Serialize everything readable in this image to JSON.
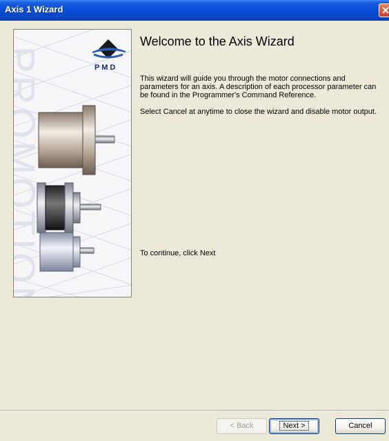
{
  "window": {
    "title": "Axis 1 Wizard",
    "close_glyph": "✕"
  },
  "art": {
    "brand": "P M D",
    "watermark": "PROMOTION"
  },
  "content": {
    "heading": "Welcome to the Axis Wizard",
    "paragraph1": "This wizard will guide you through the motor connections and parameters for an axis. A description of each processor parameter can be found in the Programmer's Command Reference.",
    "paragraph2": "Select Cancel at anytime to close the wizard and disable motor output.",
    "continue_text": "To continue, click Next"
  },
  "buttons": {
    "back": "< Back",
    "next": "Next >",
    "cancel": "Cancel"
  },
  "colors": {
    "titlebar": "#0a4ed8",
    "face": "#ece9d8",
    "disabled_text": "#a19f92"
  }
}
